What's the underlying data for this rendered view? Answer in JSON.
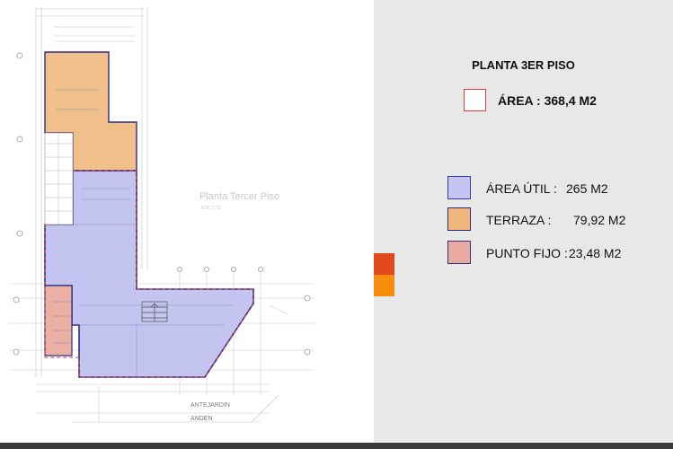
{
  "plan": {
    "caption": "Planta Tercer Piso",
    "scale": "ESC 1:75",
    "label_antejardin": "ANTEJARDIN",
    "label_anden": "ANDEN"
  },
  "legend": {
    "title": "PLANTA 3ER PISO",
    "total_area": "ÁREA : 368,4 M2",
    "items": [
      {
        "label": "ÁREA ÚTIL :",
        "value": "265 M2",
        "color": "#c4c4f0",
        "border": "#3a3aa8"
      },
      {
        "label": "TERRAZA :",
        "value": "79,92 M2",
        "color": "#f0b57a",
        "border": "#2a2a80"
      },
      {
        "label": "PUNTO FIJO :",
        "value": "23,48 M2",
        "color": "#e6aaa0",
        "border": "#3a2a80"
      }
    ]
  },
  "colors": {
    "util": "#c4c4f0",
    "terraza": "#f0bf8a",
    "punto_fijo": "#eab0a4",
    "outline_red": "#e03b3b",
    "outline_blue": "#2b2b8c",
    "marker_red": "#e24a1c",
    "marker_orange": "#f88c0c"
  }
}
